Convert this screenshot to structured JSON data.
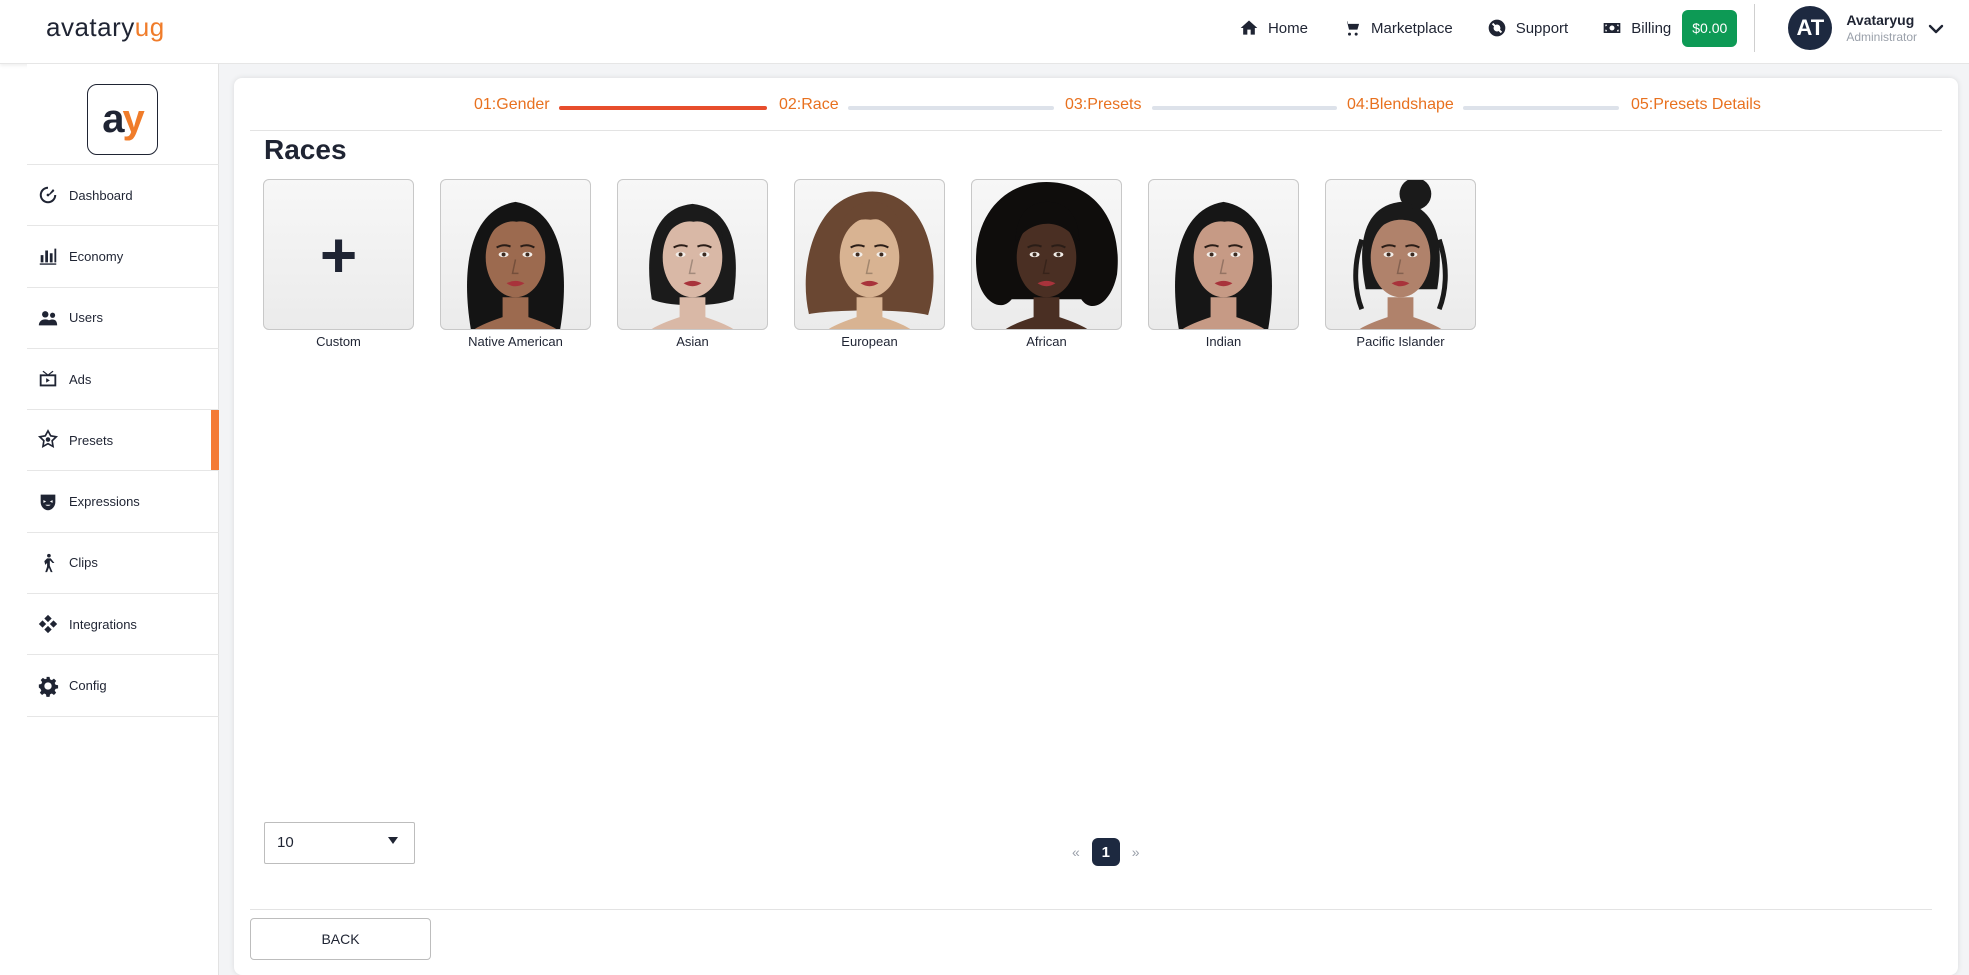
{
  "header": {
    "brand_prefix": "avatary",
    "brand_accent": "u",
    "brand_suffix": "g",
    "nav": [
      {
        "label": "Home",
        "icon": "home-icon"
      },
      {
        "label": "Marketplace",
        "icon": "cart-icon"
      },
      {
        "label": "Support",
        "icon": "lifebuoy-icon"
      },
      {
        "label": "Billing",
        "icon": "money-icon"
      }
    ],
    "balance": "$0.00",
    "user": {
      "initials": "AT",
      "name": "Avataryug",
      "role": "Administrator"
    }
  },
  "sidebar": {
    "logo_a": "a",
    "logo_y": "y",
    "items": [
      {
        "label": "Dashboard",
        "icon": "speedometer-icon"
      },
      {
        "label": "Economy",
        "icon": "bar-chart-icon"
      },
      {
        "label": "Users",
        "icon": "users-icon"
      },
      {
        "label": "Ads",
        "icon": "ads-icon"
      },
      {
        "label": "Presets",
        "icon": "presets-icon",
        "active": true
      },
      {
        "label": "Expressions",
        "icon": "mask-icon"
      },
      {
        "label": "Clips",
        "icon": "walking-icon"
      },
      {
        "label": "Integrations",
        "icon": "integration-icon"
      },
      {
        "label": "Config",
        "icon": "gear-icon"
      }
    ]
  },
  "steps": [
    {
      "label": "01:Gender"
    },
    {
      "label": "02:Race"
    },
    {
      "label": "03:Presets"
    },
    {
      "label": "04:Blendshape"
    },
    {
      "label": "05:Presets Details"
    }
  ],
  "main": {
    "title": "Races",
    "tiles": [
      {
        "label": "Custom",
        "type": "add",
        "symbol": "+"
      },
      {
        "label": "Native American",
        "skin": "#9c6a4f",
        "hair": "#141414",
        "hairstyle": "long"
      },
      {
        "label": "Asian",
        "skin": "#d9b8a6",
        "hair": "#1b1b1b",
        "hairstyle": "bob"
      },
      {
        "label": "European",
        "skin": "#d8b392",
        "hair": "#6a4732",
        "hairstyle": "wavy"
      },
      {
        "label": "African",
        "skin": "#4a2f23",
        "hair": "#0f0d0c",
        "hairstyle": "afro"
      },
      {
        "label": "Indian",
        "skin": "#c69a85",
        "hair": "#161616",
        "hairstyle": "long"
      },
      {
        "label": "Pacific Islander",
        "skin": "#b0826b",
        "hair": "#1a1a1a",
        "hairstyle": "bun"
      }
    ],
    "per_page": "10",
    "pagination": {
      "prev": "«",
      "current": "1",
      "next": "»"
    },
    "back_label": "BACK"
  },
  "colors": {
    "accent": "#f07c2a",
    "progress_done": "#e74d2c",
    "progress_todo": "#dde2ea",
    "balance_bg": "#0d9a55",
    "navy": "#1d2940"
  }
}
